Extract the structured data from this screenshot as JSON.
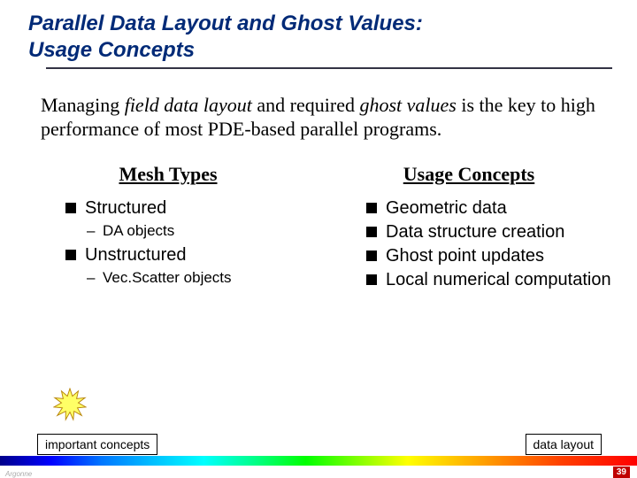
{
  "title_line1": "Parallel Data Layout and Ghost Values:",
  "title_line2": "Usage Concepts",
  "intro_parts": {
    "p1": "Managing ",
    "i1": "field data layout",
    "p2": " and required ",
    "i2": "ghost values",
    "p3": " is the key to high performance of most PDE-based parallel programs."
  },
  "col_left": {
    "heading": "Mesh Types",
    "items": [
      {
        "label": "Structured",
        "sub": "DA objects"
      },
      {
        "label": "Unstructured",
        "sub": "Vec.Scatter objects"
      }
    ]
  },
  "col_right": {
    "heading": "Usage Concepts",
    "items": [
      "Geometric data",
      "Data structure creation",
      "Ghost point updates",
      "Local numerical computation"
    ]
  },
  "callouts": {
    "left": "important concepts",
    "right": "data layout"
  },
  "page_number": "39",
  "logo_text": "Argonne"
}
